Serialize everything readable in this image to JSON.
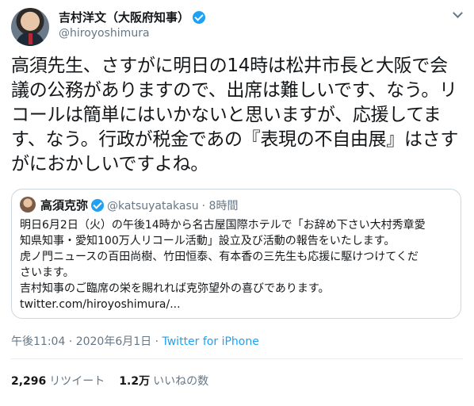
{
  "author": {
    "name": "吉村洋文（大阪府知事）",
    "handle": "@hiroyoshimura"
  },
  "tweet": {
    "text": "高須先生、さすがに明日の14時は松井市長と大阪で会議の公務がありますので、出席は難しいです、なう。リコールは簡単にはいかないと思いますが、応援してます、なう。行政が税金であの『表現の不自由展』はさすがにおかしいですよね。"
  },
  "quoted": {
    "name": "高須克弥",
    "handle": "@katsuyatakasu",
    "time": "· 8時間",
    "lines": [
      "明日6月2日（火）の午後14時から名古屋国際ホテルで「お辞め下さい大村秀章愛",
      "知県知事・愛知100万人リコール活動」設立及び活動の報告をいたします。",
      "虎ノ門ニュースの百田尚樹、竹田恒泰、有本香の三先生も応援に駆けつけてくだ",
      "さいます。",
      "吉村知事のご臨席の栄を賜れれば克弥望外の喜びであります。",
      "twitter.com/hiroyoshimura/..."
    ]
  },
  "meta": {
    "timestamp": "午後11:04 · 2020年6月1日 · ",
    "source": "Twitter for iPhone"
  },
  "stats": {
    "retweets_count": "2,296",
    "retweets_label": "リツイート",
    "likes_count": "1.2万",
    "likes_label": "いいねの数"
  },
  "colors": {
    "accent": "#1da1f2",
    "secondary_text": "#657786",
    "border": "#ccd6dd"
  }
}
